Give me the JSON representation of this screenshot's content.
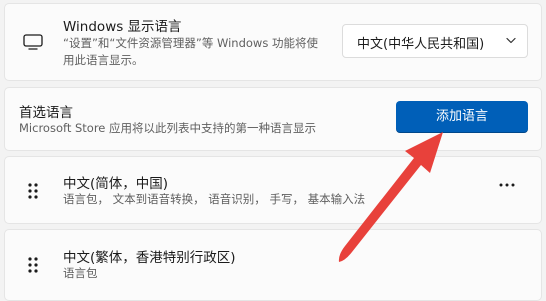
{
  "display_language": {
    "title": "Windows 显示语言",
    "description_line1": "“设置”和“文件资源管理器”等 Windows 功能将使",
    "description_line2": "用此语言显示。",
    "selected_language": "中文(中华人民共和国)",
    "icon": "monitor-icon"
  },
  "preferred_languages": {
    "title": "首选语言",
    "description": "Microsoft Store 应用将以此列表中支持的第一种语言显示",
    "add_button_label": "添加语言",
    "accent_color": "#005fb8",
    "items": [
      {
        "name": "中文(简体，中国)",
        "features": "语言包， 文本到语音转换， 语音识别， 手写， 基本输入法"
      },
      {
        "name": "中文(繁体，香港特别行政区)",
        "features": "语言包"
      }
    ]
  },
  "annotation": {
    "arrow_color": "#e8413b"
  }
}
